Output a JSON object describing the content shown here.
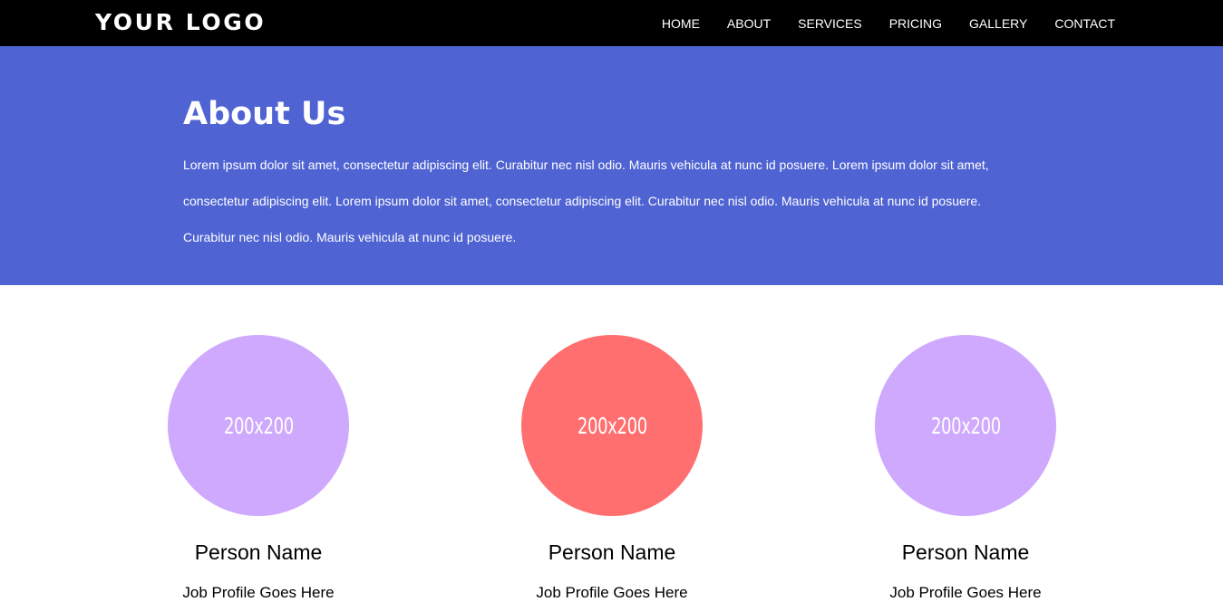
{
  "navbar": {
    "logo": "YOUR LOGO",
    "items": [
      {
        "label": "HOME"
      },
      {
        "label": "ABOUT"
      },
      {
        "label": "SERVICES"
      },
      {
        "label": "PRICING"
      },
      {
        "label": "GALLERY"
      },
      {
        "label": "CONTACT"
      }
    ]
  },
  "about": {
    "title": "About Us",
    "text": "Lorem ipsum dolor sit amet, consectetur adipiscing elit. Curabitur nec nisl odio. Mauris vehicula at nunc id posuere. Lorem ipsum dolor sit amet, consectetur adipiscing elit. Lorem ipsum dolor sit amet, consectetur adipiscing elit. Curabitur nec nisl odio. Mauris vehicula at nunc id posuere. Curabitur nec nisl odio. Mauris vehicula at nunc id posuere.",
    "background_color": "#4f63d2"
  },
  "team": [
    {
      "avatar_label": "200x200",
      "avatar_color": "#cfa9fd",
      "name": "Person Name",
      "role": "Job Profile Goes Here"
    },
    {
      "avatar_label": "200x200",
      "avatar_color": "#ff6f6f",
      "name": "Person Name",
      "role": "Job Profile Goes Here"
    },
    {
      "avatar_label": "200x200",
      "avatar_color": "#cfa9fd",
      "name": "Person Name",
      "role": "Job Profile Goes Here"
    }
  ]
}
